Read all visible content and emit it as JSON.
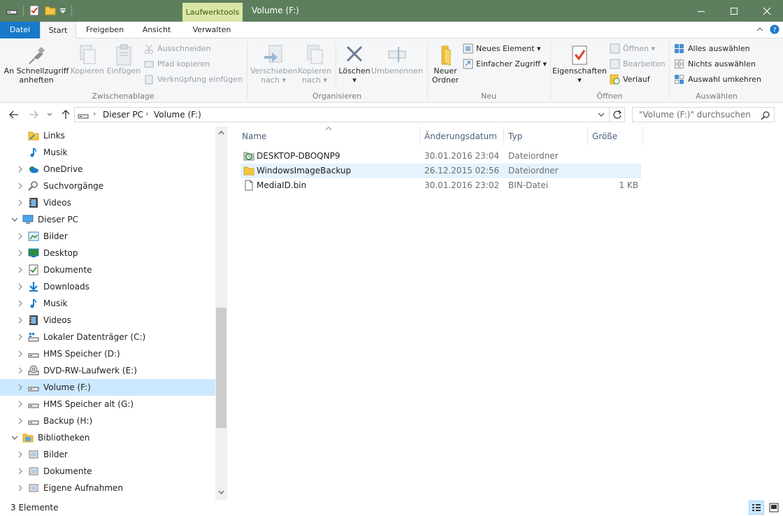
{
  "window": {
    "title": "Volume (F:)",
    "context_tab": "Laufwerktools"
  },
  "tabs": {
    "datei": "Datei",
    "start": "Start",
    "freigeben": "Freigeben",
    "ansicht": "Ansicht",
    "verwalten": "Verwalten"
  },
  "ribbon": {
    "zwischenablage": {
      "label": "Zwischenablage",
      "pin_line1": "An Schnellzugriff",
      "pin_line2": "anheften",
      "kopieren": "Kopieren",
      "einfuegen": "Einfügen",
      "ausschneiden": "Ausschneiden",
      "pfad_kopieren": "Pfad kopieren",
      "verknuepfung": "Verknüpfung einfügen"
    },
    "organisieren": {
      "label": "Organisieren",
      "verschieben_line1": "Verschieben",
      "verschieben_line2": "nach",
      "kopieren_line1": "Kopieren",
      "kopieren_line2": "nach",
      "loeschen": "Löschen",
      "umbenennen": "Umbenennen"
    },
    "neu": {
      "label": "Neu",
      "ordner_line1": "Neuer",
      "ordner_line2": "Ordner",
      "neues_element": "Neues Element",
      "einfacher_zugriff": "Einfacher Zugriff"
    },
    "oeffnen": {
      "label": "Öffnen",
      "eigenschaften": "Eigenschaften",
      "oeffnen": "Öffnen",
      "bearbeiten": "Bearbeiten",
      "verlauf": "Verlauf"
    },
    "auswaehlen": {
      "label": "Auswählen",
      "alles": "Alles auswählen",
      "nichts": "Nichts auswählen",
      "umkehren": "Auswahl umkehren"
    }
  },
  "address": {
    "crumbs": [
      "Dieser PC",
      "Volume (F:)"
    ],
    "search_placeholder": "\"Volume (F:)\" durchsuchen"
  },
  "nav": [
    {
      "label": "Links",
      "icon": "link-folder-icon",
      "level": 1,
      "chev": "none"
    },
    {
      "label": "Musik",
      "icon": "music-icon",
      "level": 1,
      "chev": "none"
    },
    {
      "label": "OneDrive",
      "icon": "onedrive-icon",
      "level": 1,
      "chev": "right"
    },
    {
      "label": "Suchvorgänge",
      "icon": "search-icon",
      "level": 1,
      "chev": "right"
    },
    {
      "label": "Videos",
      "icon": "video-icon",
      "level": 1,
      "chev": "right"
    },
    {
      "label": "Dieser PC",
      "icon": "computer-icon",
      "level": 0,
      "chev": "down"
    },
    {
      "label": "Bilder",
      "icon": "pictures-icon",
      "level": 1,
      "chev": "right"
    },
    {
      "label": "Desktop",
      "icon": "desktop-icon",
      "level": 1,
      "chev": "right"
    },
    {
      "label": "Dokumente",
      "icon": "documents-icon",
      "level": 1,
      "chev": "right"
    },
    {
      "label": "Downloads",
      "icon": "downloads-icon",
      "level": 1,
      "chev": "right"
    },
    {
      "label": "Musik",
      "icon": "music-icon",
      "level": 1,
      "chev": "right"
    },
    {
      "label": "Videos",
      "icon": "video-icon",
      "level": 1,
      "chev": "right"
    },
    {
      "label": "Lokaler Datenträger (C:)",
      "icon": "system-drive-icon",
      "level": 1,
      "chev": "right"
    },
    {
      "label": "HMS Speicher (D:)",
      "icon": "drive-icon",
      "level": 1,
      "chev": "right"
    },
    {
      "label": "DVD-RW-Laufwerk (E:)",
      "icon": "dvd-drive-icon",
      "level": 1,
      "chev": "right"
    },
    {
      "label": "Volume (F:)",
      "icon": "drive-icon",
      "level": 1,
      "chev": "right",
      "selected": true
    },
    {
      "label": "HMS Speicher alt (G:)",
      "icon": "drive-icon",
      "level": 1,
      "chev": "right"
    },
    {
      "label": "Backup (H:)",
      "icon": "drive-icon",
      "level": 1,
      "chev": "right"
    },
    {
      "label": "Bibliotheken",
      "icon": "libraries-icon",
      "level": 0,
      "chev": "down"
    },
    {
      "label": "Bilder",
      "icon": "library-icon",
      "level": 1,
      "chev": "right"
    },
    {
      "label": "Dokumente",
      "icon": "library-icon",
      "level": 1,
      "chev": "right"
    },
    {
      "label": "Eigene Aufnahmen",
      "icon": "library-icon",
      "level": 1,
      "chev": "right"
    }
  ],
  "columns": {
    "name": "Name",
    "date": "Änderungsdatum",
    "type": "Typ",
    "size": "Größe"
  },
  "files": [
    {
      "name": "DESKTOP-DBOQNP9",
      "date": "30.01.2016 23:04",
      "type": "Dateiordner",
      "size": "",
      "icon": "backup-folder-icon"
    },
    {
      "name": "WindowsImageBackup",
      "date": "26.12.2015 02:56",
      "type": "Dateiordner",
      "size": "",
      "icon": "folder-icon",
      "selected": true
    },
    {
      "name": "MediaID.bin",
      "date": "30.01.2016 23:02",
      "type": "BIN-Datei",
      "size": "1 KB",
      "icon": "file-icon"
    }
  ],
  "status": {
    "count": "3 Elemente"
  },
  "colors": {
    "titlebar": "#5e7f5e",
    "datei_tab": "#1979ca",
    "context_tab": "#dbe8a5",
    "selection": "#cce8ff"
  }
}
